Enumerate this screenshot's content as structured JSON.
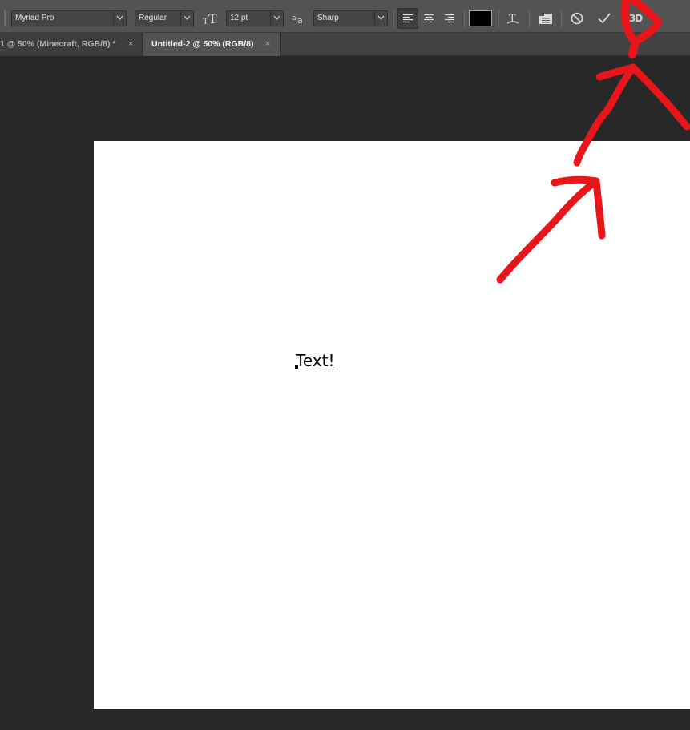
{
  "options_bar": {
    "font_family": "Myriad Pro",
    "font_style": "Regular",
    "font_size": "12 pt",
    "antialias": "Sharp",
    "text_color": "#000000",
    "icons": {
      "size": "font-size-icon",
      "antialias": "antialias-icon",
      "align_left": "align-left-icon",
      "align_center": "align-center-icon",
      "align_right": "align-right-icon",
      "warp": "warp-text-icon",
      "panels": "character-paragraph-panels-icon",
      "cancel": "cancel-icon",
      "commit": "commit-checkmark-icon",
      "three_d": "3d-icon"
    },
    "three_d_label": "3D"
  },
  "tabs": [
    {
      "label": "1 @ 50% (Minecraft, RGB/8) *",
      "active": false,
      "close": "×"
    },
    {
      "label": "Untitled-2 @ 50% (RGB/8)",
      "active": true,
      "close": "×"
    }
  ],
  "canvas": {
    "text": "Text!"
  },
  "colors": {
    "ui_dark": "#282828",
    "options_bar": "#535353",
    "annotation": "#e8161b"
  }
}
